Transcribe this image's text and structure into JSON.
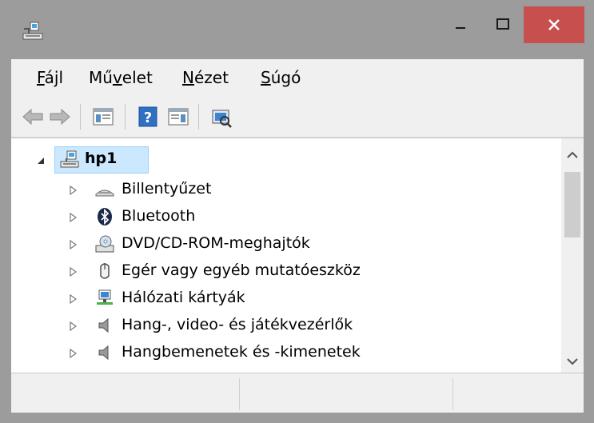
{
  "window": {
    "icon": "computer-tree-icon",
    "controls": {
      "minimize": "minimize-icon",
      "maximize": "maximize-icon",
      "close": "close-icon",
      "close_color": "#c7504f"
    }
  },
  "menu": {
    "items": [
      {
        "label": "Fájl",
        "accel": "F"
      },
      {
        "label": "Művelet",
        "accel": "v"
      },
      {
        "label": "Nézet",
        "accel": "N"
      },
      {
        "label": "Súgó",
        "accel": "S"
      }
    ]
  },
  "toolbar": {
    "buttons": [
      "back-arrow-icon",
      "forward-arrow-icon",
      "console-tree-icon",
      "help-icon",
      "action-pane-icon",
      "scan-hardware-icon"
    ]
  },
  "tree": {
    "root": {
      "label": "hp1",
      "icon": "computer-icon"
    },
    "children": [
      {
        "label": "Billentyűzet",
        "icon": "keyboard-icon"
      },
      {
        "label": "Bluetooth",
        "icon": "bluetooth-icon"
      },
      {
        "label": "DVD/CD-ROM-meghajtók",
        "icon": "dvd-drive-icon"
      },
      {
        "label": "Egér vagy egyéb mutatóeszköz",
        "icon": "mouse-icon"
      },
      {
        "label": "Hálózati kártyák",
        "icon": "network-adapter-icon"
      },
      {
        "label": "Hang-, video- és játékvezérlők",
        "icon": "speaker-icon"
      },
      {
        "label": "Hangbemenetek és -kimenetek",
        "icon": "audio-io-icon"
      }
    ]
  },
  "colors": {
    "titlebar": "#9c9c9c",
    "selection": "#cce8ff",
    "selection_border": "#99d1ff"
  }
}
